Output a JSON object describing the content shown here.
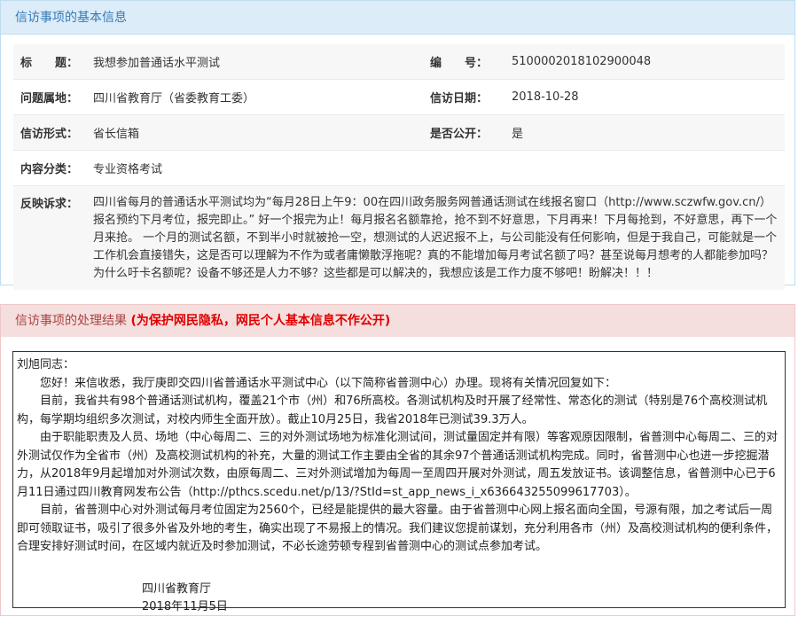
{
  "basic": {
    "title": "信访事项的基本信息",
    "rows": {
      "subject_label": "标　　题：",
      "subject": "我想参加普通话水平测试",
      "number_label": "编　　号：",
      "number": "5100002018102900048",
      "location_label": "问题属地：",
      "location": "四川省教育厅（省委教育工委）",
      "date_label": "信访日期：",
      "date": "2018-10-28",
      "form_label": "信访形式：",
      "form": "省长信箱",
      "public_label": "是否公开：",
      "public": "是",
      "category_label": "内容分类：",
      "category": "专业资格考试",
      "appeal_label": "反映诉求：",
      "appeal": "四川省每月的普通话水平测试均为“每月28日上午9：00在四川政务服务网普通话测试在线报名窗口（http://www.sczwfw.gov.cn/）报名预约下月考位，报完即止。” 好一个报完为止！每月报名名额靠抢，抢不到不好意思，下月再来！下月每抢到，不好意思，再下一个月来抢。 一个月的测试名额，不到半小时就被抢一空，想测试的人迟迟报不上，与公司能没有任何影响，但是于我自己，可能就是一个工作机会直接错失，这是否可以理解为不作为或者庸懒散浮拖呢？真的不能增加每月考试名额了吗？甚至说每月想考的人都能参加吗？为什么吁卡名额呢？设备不够还是人力不够？这些都是可以解决的，我想应该是工作力度不够吧！盼解决！！！"
    }
  },
  "result": {
    "title": "信访事项的处理结果",
    "privacy_note": "(为保护网民隐私，网民个人基本信息不作公开)",
    "salutation": "刘旭同志：",
    "paragraphs": [
      "您好！来信收悉，我厅庚即交四川省普通话水平测试中心（以下简称省普测中心）办理。现将有关情况回复如下：",
      "目前，我省共有98个普通话测试机构，覆盖21个市（州）和76所高校。各测试机构及时开展了经常性、常态化的测试（特别是76个高校测试机构，每学期均组织多次测试，对校内师生全面开放）。截止10月25日，我省2018年已测试39.3万人。",
      "由于职能职责及人员、场地（中心每周二、三的对外测试场地为标准化测试间，测试量固定并有限）等客观原因限制，省普测中心每周二、三的对外测试仅作为全省市（州）及高校测试机构的补充，大量的测试工作主要由全省的其余97个普通话测试机构完成。同时，省普测中心也进一步挖掘潜力，从2018年9月起增加对外测试次数，由原每周二、三对外测试增加为每周一至周四开展对外测试，周五发放证书。该调整信息，省普测中心已于6月11日通过四川教育网发布公告（http://pthcs.scedu.net/p/13/?StId=st_app_news_i_x636643255099617703）。",
      "目前，省普测中心对外测试每月考位固定为2560个，已经是能提供的最大容量。由于省普测中心网上报名面向全国，号源有限，加之考试后一周即可领取证书，吸引了很多外省及外地的考生，确实出现了不易报上的情况。我们建议您提前谋划，充分利用各市（州）及高校测试机构的便利条件，合理安排好测试时间，在区域内就近及时参加测试，不必长途劳顿专程到省普测中心的测试点参加考试。"
    ],
    "sign_org": "四川省教育厅",
    "sign_date": "2018年11月5日"
  }
}
